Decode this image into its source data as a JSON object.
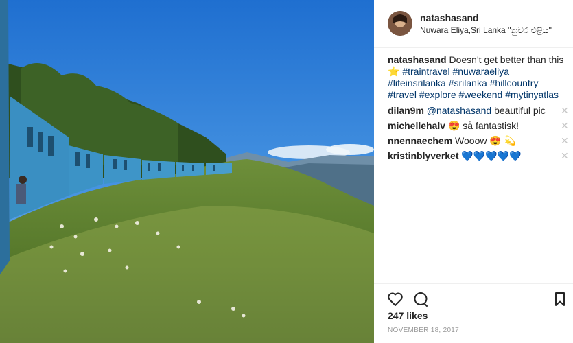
{
  "post": {
    "image_alt": "Blue train winding along a green hillside",
    "username": "natashasand",
    "location": "Nuwara Eliya,Sri Lanka ''නුවර එළිය''"
  },
  "caption": {
    "user": "natashasand",
    "text": "Doesn't get better than this",
    "star": "⭐",
    "tags": [
      "#traintravel",
      "#nuwaraeliya",
      "#lifeinsrilanka",
      "#srilanka",
      "#hillcountry",
      "#travel",
      "#explore",
      "#weekend",
      "#mytinyatlas"
    ]
  },
  "comments": [
    {
      "user": "dilan9m",
      "mention": "@natashasand",
      "text": " beautiful pic"
    },
    {
      "user": "michellehalv",
      "emoji": "😍",
      "text": " så fantastisk!"
    },
    {
      "user": "nnennaechem",
      "text": "Wooow ",
      "emoji": "😍 💫"
    },
    {
      "user": "kristinblyverket",
      "emoji": "💙💙💙💙💙"
    }
  ],
  "actions": {
    "like_icon": "heart-icon",
    "comment_icon": "comment-icon",
    "save_icon": "bookmark-icon"
  },
  "likes_text": "247 likes",
  "date_text": "NOVEMBER 18, 2017",
  "colors": {
    "link": "#003569",
    "muted": "#999999",
    "divider": "#efefef",
    "sky": "#2f7fd8",
    "train": "#3a8fc2"
  }
}
